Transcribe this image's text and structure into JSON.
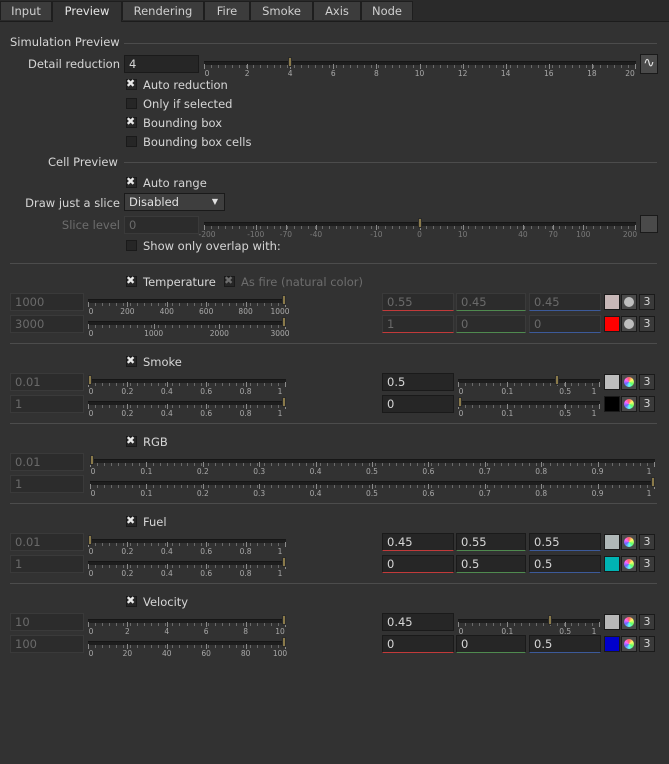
{
  "tabs": [
    "Input",
    "Preview",
    "Rendering",
    "Fire",
    "Smoke",
    "Axis",
    "Node"
  ],
  "sim": {
    "title": "Simulation Preview",
    "detail_label": "Detail reduction",
    "detail_value": "4",
    "detail_ticks": [
      "0",
      "2",
      "4",
      "6",
      "8",
      "10",
      "12",
      "14",
      "16",
      "18",
      "20"
    ],
    "auto_reduction": "Auto reduction",
    "only_selected": "Only if selected",
    "bbox": "Bounding box",
    "bbox_cells": "Bounding box cells"
  },
  "cell": {
    "title": "Cell Preview",
    "auto_range": "Auto range",
    "slice_label": "Draw just a slice",
    "slice_value": "Disabled",
    "slice_level_label": "Slice level",
    "slice_level_value": "0",
    "slice_ticks": [
      "-200",
      "-100",
      "-70",
      "-40",
      "-10",
      "0",
      "10",
      "40",
      "70",
      "100",
      "200"
    ],
    "overlap": "Show only overlap with:"
  },
  "temp": {
    "label": "Temperature",
    "fire": "As fire (natural color)",
    "min": "1000",
    "max": "3000",
    "ticks1": [
      "0",
      "200",
      "400",
      "600",
      "800",
      "1000"
    ],
    "ticks2": [
      "0",
      "1000",
      "2000",
      "3000"
    ],
    "c1": [
      "0.55",
      "0.45",
      "0.45"
    ],
    "c2": [
      "1",
      "0",
      "0"
    ],
    "n1": "3",
    "n2": "3"
  },
  "smoke": {
    "label": "Smoke",
    "min": "0.01",
    "max": "1",
    "ticks": [
      "0",
      "0.2",
      "0.4",
      "0.6",
      "0.8",
      "1"
    ],
    "v1": "0.5",
    "v2": "0",
    "ticksR": [
      "0",
      "0.1",
      "0.5",
      "1"
    ],
    "n1": "3",
    "n2": "3"
  },
  "rgb": {
    "label": "RGB",
    "min": "0.01",
    "max": "1",
    "ticks": [
      "0",
      "0.1",
      "0.2",
      "0.3",
      "0.4",
      "0.5",
      "0.6",
      "0.7",
      "0.8",
      "0.9",
      "1"
    ]
  },
  "fuel": {
    "label": "Fuel",
    "min": "0.01",
    "max": "1",
    "ticks": [
      "0",
      "0.2",
      "0.4",
      "0.6",
      "0.8",
      "1"
    ],
    "c1": [
      "0.45",
      "0.55",
      "0.55"
    ],
    "c2": [
      "0",
      "0.5",
      "0.5"
    ],
    "n1": "3",
    "n2": "3"
  },
  "vel": {
    "label": "Velocity",
    "min": "10",
    "max": "100",
    "ticks1": [
      "0",
      "2",
      "4",
      "6",
      "8",
      "10"
    ],
    "ticks2": [
      "0",
      "20",
      "40",
      "60",
      "80",
      "100"
    ],
    "v1": "0.45",
    "ticksR": [
      "0",
      "0.1",
      "0.5",
      "1"
    ],
    "c2": [
      "0",
      "0",
      "0.5"
    ],
    "n1": "3",
    "n2": "3"
  },
  "colors": {
    "temp1": "#c8b8b8",
    "temp2": "#ff0000",
    "smoke1": "#bdbdbd",
    "smoke2": "#000000",
    "fuel1": "#b0b8b8",
    "fuel2": "#00b3b3",
    "vel1": "#b8b8b8",
    "vel2": "#0000cc"
  }
}
